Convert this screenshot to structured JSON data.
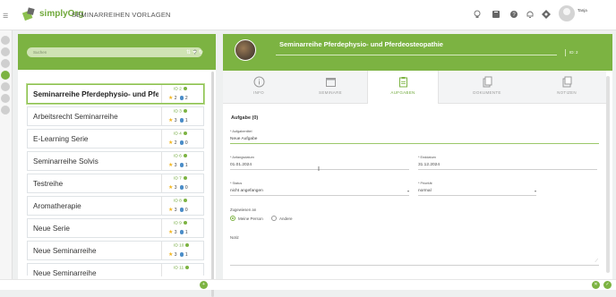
{
  "header": {
    "brand_name": "simplyOrg",
    "app_title": "SEMINARREIHEN VORLAGEN",
    "user_name": "Tanja",
    "icons": [
      "lightbulb-icon",
      "book-icon",
      "help-icon",
      "bell-icon",
      "dashboard-icon"
    ]
  },
  "left_panel": {
    "search_placeholder": "Suchen",
    "items": [
      {
        "title": "Seminarreihe Pferdephysio- und Pferd...",
        "id": "ID 2",
        "stars": "2",
        "count": "2"
      },
      {
        "title": "Arbeitsrecht Seminarreihe",
        "id": "ID 3",
        "stars": "3",
        "count": "1"
      },
      {
        "title": "E-Learning Serie",
        "id": "ID 4",
        "stars": "2",
        "count": "0"
      },
      {
        "title": "Seminarreihe Solvis",
        "id": "ID 6",
        "stars": "3",
        "count": "1"
      },
      {
        "title": "Testreihe",
        "id": "ID 7",
        "stars": "3",
        "count": "0"
      },
      {
        "title": "Aromatherapie",
        "id": "ID 8",
        "stars": "3",
        "count": "0"
      },
      {
        "title": "Neue Serie",
        "id": "ID 9",
        "stars": "3",
        "count": "1"
      },
      {
        "title": "Neue Seminarreihe",
        "id": "ID 10",
        "stars": "3",
        "count": "1"
      },
      {
        "title": "Neue Seminarreihe",
        "id": "ID 11",
        "stars": "",
        "count": ""
      }
    ]
  },
  "detail": {
    "title": "Seminarreihe Pferdephysio- und Pferdeosteopathie",
    "badge": "ID: 2",
    "tabs": [
      {
        "label": "INFO",
        "icon": "info-icon"
      },
      {
        "label": "SEMINARE",
        "icon": "calendar-icon"
      },
      {
        "label": "AUFGABEN",
        "icon": "clipboard-icon"
      },
      {
        "label": "DOKUMENTE",
        "icon": "documents-icon"
      },
      {
        "label": "NOTIZEN",
        "icon": "notes-icon"
      }
    ],
    "active_tab": "AUFGABEN",
    "form": {
      "section_title": "Aufgabe (0)",
      "task_title_label": "* Aufgabentitel",
      "task_title_value": "Neue Aufgabe",
      "start_label": "* Anfangsdatum",
      "start_value": "01.01.2024",
      "end_label": "* Enddatum",
      "end_value": "31.12.2024",
      "status_label": "* Status",
      "status_value": "nicht angefangen",
      "priority_label": "* Priorität",
      "priority_value": "normal",
      "assigned_label": "Zugewiesen an",
      "assign_options": [
        "Meine Person",
        "Andere"
      ],
      "assign_selected": "Meine Person",
      "note_label": "Notiz",
      "note_value": ""
    }
  }
}
